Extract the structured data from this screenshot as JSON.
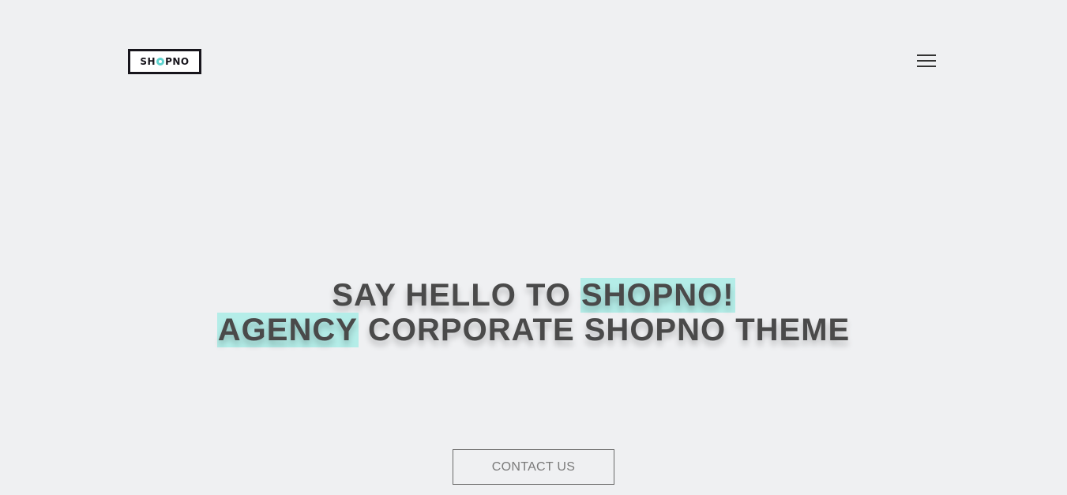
{
  "header": {
    "logo": {
      "text_before": "SH",
      "text_after": "PNO",
      "accent_color": "#5ed3cf",
      "border_color": "#17151c"
    },
    "menu_icon": "hamburger-menu-icon"
  },
  "hero": {
    "line1_plain": "SAY HELLO TO ",
    "line1_highlight": "SHOPNO!",
    "line2_highlight": "AGENCY",
    "line2_plain": " CORPORATE SHOPNO THEME",
    "highlight_color": "#b4ede8"
  },
  "cta": {
    "label": "CONTACT US"
  },
  "colors": {
    "background": "#eff0f2",
    "heading": "#4a4a4a"
  }
}
